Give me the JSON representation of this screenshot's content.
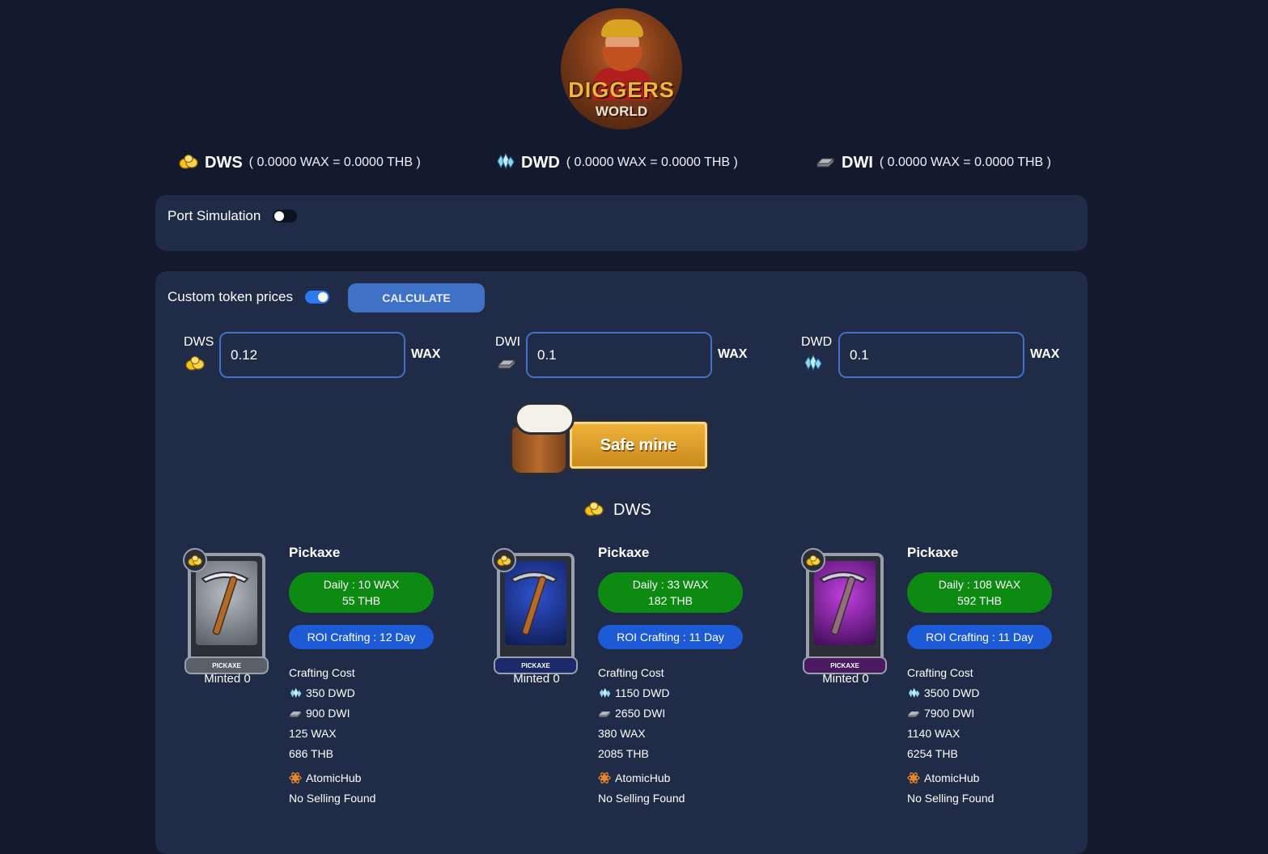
{
  "logo": {
    "line1": "DIGGERS",
    "line2": "WORLD"
  },
  "tokens": [
    {
      "name": "DWS",
      "rate": "( 0.0000 WAX = 0.0000 THB )",
      "icon": "gold-nugget-icon"
    },
    {
      "name": "DWD",
      "rate": "( 0.0000 WAX = 0.0000 THB )",
      "icon": "diamond-crystal-icon"
    },
    {
      "name": "DWI",
      "rate": "( 0.0000 WAX = 0.0000 THB )",
      "icon": "iron-ingot-icon"
    }
  ],
  "port_simulation": {
    "label": "Port Simulation",
    "enabled": false
  },
  "custom_prices": {
    "label": "Custom token prices",
    "enabled": true,
    "calculate_label": "CALCULATE",
    "inputs": [
      {
        "token": "DWS",
        "value": "0.12",
        "unit": "WAX"
      },
      {
        "token": "DWI",
        "value": "0.1",
        "unit": "WAX"
      },
      {
        "token": "DWD",
        "value": "0.1",
        "unit": "WAX"
      }
    ]
  },
  "safe_mine": {
    "label": "Safe mine"
  },
  "section": {
    "title": "DWS"
  },
  "cards": [
    {
      "title": "Pickaxe",
      "plate": "PICKAXE",
      "minted": "Minted 0",
      "daily_wax": "Daily : 10 WAX",
      "daily_thb": "55 THB",
      "roi": "ROI Crafting : 12 Day",
      "cost_label": "Crafting Cost",
      "dwd": "350 DWD",
      "dwi": "900 DWI",
      "wax": "125 WAX",
      "thb": "686 THB",
      "market": "AtomicHub",
      "selling": "No Selling Found",
      "rarity_color": "#9aa0ab",
      "art_color": "#8c9099"
    },
    {
      "title": "Pickaxe",
      "plate": "PICKAXE",
      "minted": "Minted 0",
      "daily_wax": "Daily : 33 WAX",
      "daily_thb": "182 THB",
      "roi": "ROI Crafting : 11 Day",
      "cost_label": "Crafting Cost",
      "dwd": "1150 DWD",
      "dwi": "2650 DWI",
      "wax": "380 WAX",
      "thb": "2085 THB",
      "market": "AtomicHub",
      "selling": "No Selling Found",
      "rarity_color": "#9aa0ab",
      "art_color": "#1f3ea8"
    },
    {
      "title": "Pickaxe",
      "plate": "PICKAXE",
      "minted": "Minted 0",
      "daily_wax": "Daily : 108 WAX",
      "daily_thb": "592 THB",
      "roi": "ROI Crafting : 11 Day",
      "cost_label": "Crafting Cost",
      "dwd": "3500 DWD",
      "dwi": "7900 DWI",
      "wax": "1140 WAX",
      "thb": "6254 THB",
      "market": "AtomicHub",
      "selling": "No Selling Found",
      "rarity_color": "#9aa0ab",
      "art_color": "#8a1fa8"
    }
  ]
}
